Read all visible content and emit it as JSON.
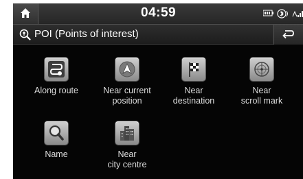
{
  "status": {
    "time": "04:59",
    "icons": [
      "home-icon",
      "battery-icon",
      "bluetooth-icon",
      "signal-icon"
    ]
  },
  "header": {
    "title": "POI (Points of interest)",
    "title_icon": "poi-search-icon",
    "back_icon": "back-arrow-icon"
  },
  "items": [
    {
      "label": "Along route",
      "icon": "along-route-icon"
    },
    {
      "label": "Near current\nposition",
      "icon": "compass-arrow-icon"
    },
    {
      "label": "Near\ndestination",
      "icon": "checkered-flag-icon"
    },
    {
      "label": "Near\nscroll mark",
      "icon": "crosshair-icon"
    },
    {
      "label": "Name",
      "icon": "magnifier-icon"
    },
    {
      "label": "Near\ncity centre",
      "icon": "city-buildings-icon"
    }
  ],
  "colors": {
    "background": "#050505",
    "bar": "#2a2a2a",
    "text": "#dddddd",
    "icon_tile": "#b0b0b0"
  }
}
